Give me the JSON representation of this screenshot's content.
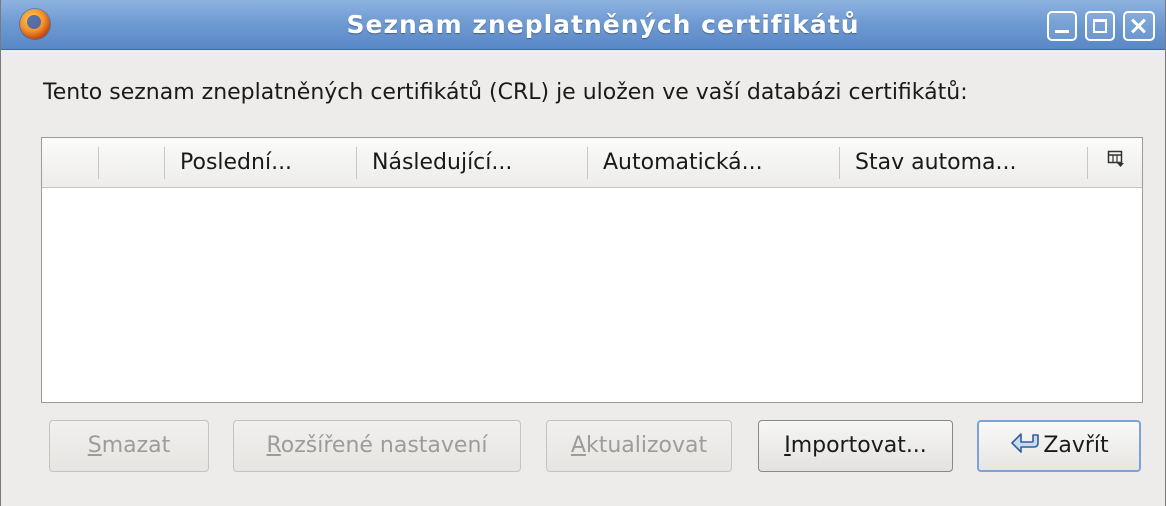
{
  "window": {
    "title": "Seznam zneplatněných certifikátů",
    "title_bar_color": "#6f9bd3",
    "app_icon": "firefox-icon",
    "controls": [
      "minimize-icon",
      "maximize-icon",
      "close-icon"
    ]
  },
  "description": "Tento seznam zneplatněných certifikátů (CRL) je uložen ve vaší databázi certifikátů:",
  "table": {
    "columns": [
      "",
      "",
      "Poslední...",
      "Následující...",
      "Automatická...",
      "Stav automa..."
    ],
    "column_picker_icon": "column-picker-icon",
    "rows": []
  },
  "buttons": {
    "delete": {
      "mnemonic": "S",
      "rest": "mazat"
    },
    "advanced": {
      "mnemonic": "R",
      "rest": "ozšířené nastavení"
    },
    "update": {
      "mnemonic": "A",
      "rest": "ktualizovat"
    },
    "import": {
      "mnemonic": "I",
      "rest": "mportovat..."
    },
    "close": {
      "label": "Zavřít",
      "icon": "return-arrow-icon"
    }
  },
  "colors": {
    "window_bg": "#edeceb",
    "disabled_text": "#9d9c99",
    "focus_border": "#7ba3d8"
  }
}
